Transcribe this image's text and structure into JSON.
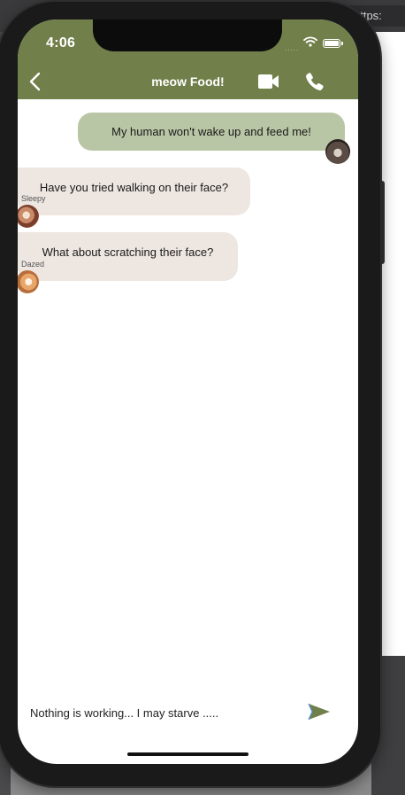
{
  "browser": {
    "url_fragment": "https:"
  },
  "status_bar": {
    "time": "4:06",
    "signal_dots": "....."
  },
  "header": {
    "title": "meow Food!",
    "back_icon": "chevron-left-icon",
    "video_icon": "video-camera-icon",
    "call_icon": "phone-icon"
  },
  "messages": [
    {
      "direction": "outgoing",
      "text": "My human won't wake up and feed me!",
      "sender": ""
    },
    {
      "direction": "incoming",
      "text": "Have you tried walking on their face?",
      "sender": "Sleepy"
    },
    {
      "direction": "incoming",
      "text": "What about scratching their face?",
      "sender": "Dazed"
    }
  ],
  "composer": {
    "value": "Nothing is working... I may starve .....",
    "send_icon": "send-icon"
  },
  "colors": {
    "header": "#717f4a",
    "outgoing_bubble": "#b9c6a5",
    "incoming_bubble": "#ede6e1",
    "send_icon": "#717f4a"
  }
}
